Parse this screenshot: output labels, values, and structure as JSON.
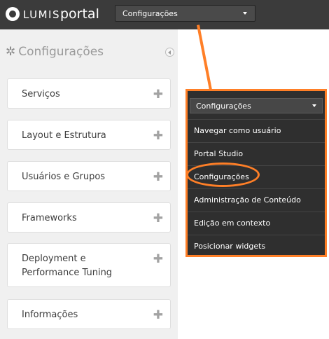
{
  "colors": {
    "topbar": "#3b3b3b",
    "sidebar": "#f0f0f0",
    "accent_annotation": "#ff7f27",
    "menu_bg": "#2f2f2f"
  },
  "topbar": {
    "logo": {
      "lumis": "LUMIS",
      "portal": "portal"
    },
    "mode_select": {
      "value": "Configurações",
      "icon": "chevron-down-icon"
    }
  },
  "sidebar": {
    "title": "Configurações",
    "title_icon": "wrench-tools-icon",
    "collapse_icon": "collapse-left-icon",
    "items": [
      {
        "label": "Serviços",
        "icon": "plus-icon"
      },
      {
        "label": "Layout e Estrutura",
        "icon": "plus-icon"
      },
      {
        "label": "Usuários e Grupos",
        "icon": "plus-icon"
      },
      {
        "label": "Frameworks",
        "icon": "plus-icon"
      },
      {
        "label": "Deployment e Performance Tuning",
        "icon": "plus-icon"
      },
      {
        "label": "Informações",
        "icon": "plus-icon"
      }
    ]
  },
  "dropdown": {
    "selected": "Configurações",
    "options": [
      "Navegar como usuário",
      "Portal Studio",
      "Configurações",
      "Administração de Conteúdo",
      "Edição em contexto",
      "Posicionar widgets"
    ]
  }
}
